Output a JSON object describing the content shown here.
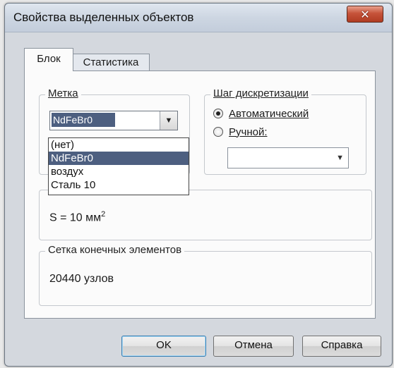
{
  "window": {
    "title": "Свойства выделенных объектов"
  },
  "tabs": [
    {
      "label": "Блок",
      "active": true
    },
    {
      "label": "Статистика",
      "active": false
    }
  ],
  "label_group": {
    "title": "Метка",
    "selected_value": "NdFeBr0",
    "options": [
      "(нет)",
      "NdFeBr0",
      "воздух",
      "Сталь 10"
    ]
  },
  "step_group": {
    "title": "Шаг дискретизации",
    "auto_label": "Автоматический",
    "auto_checked": true,
    "manual_label": "Ручной:",
    "manual_checked": false,
    "manual_value": ""
  },
  "area": {
    "text": "S = 10 мм",
    "superscript": "2"
  },
  "mesh_group": {
    "title": "Сетка конечных элементов",
    "nodes_text": "20440 узлов"
  },
  "buttons": {
    "ok": "OK",
    "cancel": "Отмена",
    "help": "Справка"
  },
  "icons": {
    "close": "close-icon",
    "combo_arrow": "chevron-down-icon"
  }
}
